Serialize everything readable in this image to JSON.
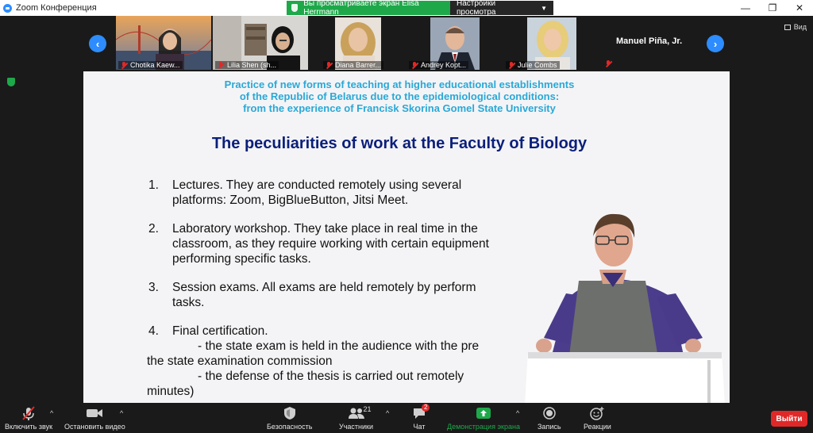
{
  "window": {
    "title": "Zoom Конференция"
  },
  "share_banner": {
    "status": "Вы просматриваете экран Elisa Herrmann",
    "view_options": "Настройки просмотра"
  },
  "view_toggle": "Вид",
  "gallery": {
    "participants": [
      {
        "name": "Chotika Kaew..."
      },
      {
        "name": "Lilia Shen (sh..."
      },
      {
        "name": "Diana Barrer..."
      },
      {
        "name": "Andrey Kopt..."
      },
      {
        "name": "Julie Combs"
      }
    ],
    "extra_name": "Manuel Piña, Jr."
  },
  "slide": {
    "header_lines": [
      "Practice of new forms of teaching at higher educational establishments",
      "of the Republic of Belarus due to the epidemiological  conditions:",
      "from the experience  of Francisk Skorina Gomel State University"
    ],
    "title": "The peculiarities of work at the Faculty of Biology",
    "points": [
      {
        "num": "1.",
        "lines": [
          "Lectures. They are conducted remotely using several",
          "platforms: Zoom, BigBlueButton, Jitsi Meet."
        ]
      },
      {
        "num": "2.",
        "lines": [
          "Laboratory workshop. They take place in real time in the",
          "classroom, as they require working with certain equipment",
          "performing specific tasks."
        ]
      },
      {
        "num": "3.",
        "lines": [
          "Session exams. All exams are held remotely by perform",
          "tasks."
        ]
      },
      {
        "num": "4.",
        "lines": [
          "Final certification.",
          "- the state exam  is held in the audience with the pre",
          "the state examination commission",
          "- the defense of the thesis is carried out remotely",
          "minutes)"
        ]
      }
    ]
  },
  "toolbar": {
    "unmute": "Включить звук",
    "start_video": "Остановить видео",
    "security": "Безопасность",
    "participants": "Участники",
    "participants_count": "21",
    "chat": "Чат",
    "chat_badge": "2",
    "share_screen": "Демонстрация экрана",
    "record": "Запись",
    "reactions": "Реакции",
    "leave": "Выйти"
  },
  "colors": {
    "accent": "#2d8cff",
    "share_green": "#1ea84a",
    "leave_red": "#e02828",
    "slide_header": "#2aa8d6",
    "slide_title": "#0b1f7a"
  }
}
